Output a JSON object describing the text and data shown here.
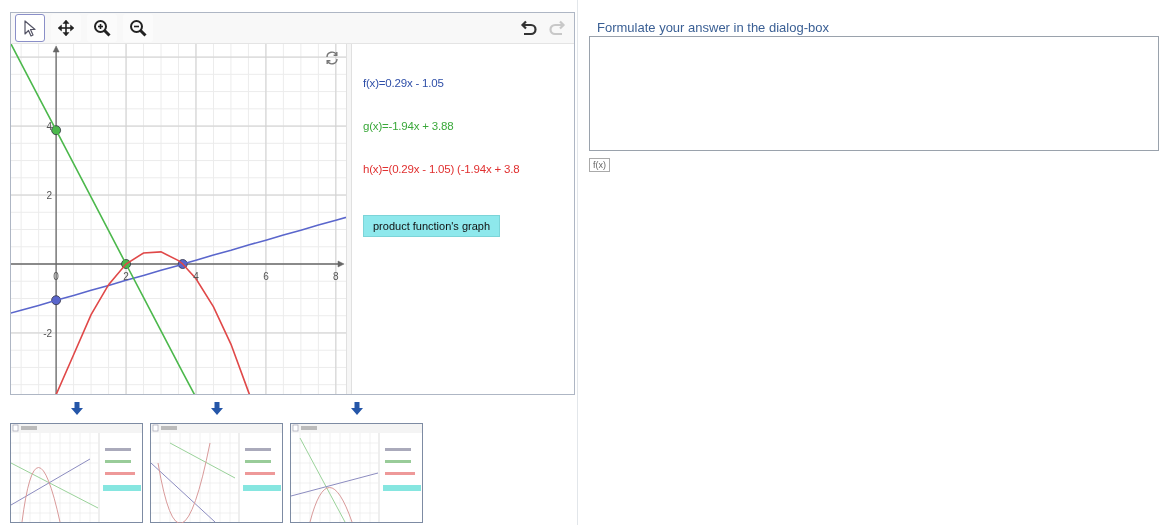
{
  "applet": {
    "toolbar": {
      "tools": [
        {
          "kind": "pointer",
          "selected": true
        },
        {
          "kind": "move",
          "selected": false
        },
        {
          "kind": "zoom_in",
          "selected": false
        },
        {
          "kind": "zoom_out",
          "selected": false
        }
      ],
      "history": [
        {
          "kind": "undo",
          "disabled": false
        },
        {
          "kind": "redo",
          "disabled": true
        }
      ]
    },
    "graph": {
      "chart_data": {
        "type": "line",
        "x": [
          -1,
          -0.5,
          0,
          0.5,
          1,
          1.5,
          2,
          2.5,
          3,
          3.5,
          3.62,
          4,
          4.5,
          5,
          5.5,
          6,
          6.5,
          7,
          7.5,
          8
        ],
        "series": [
          {
            "color": "#5a66cc",
            "values": [
              -1.34,
              -1.2,
              -1.05,
              -0.91,
              -0.76,
              -0.62,
              -0.47,
              -0.33,
              -0.18,
              -0.04,
              0,
              0.11,
              0.26,
              0.4,
              0.55,
              0.69,
              0.84,
              0.98,
              1.13,
              1.27
            ]
          },
          {
            "color": "#4cb84c",
            "values": [
              5.82,
              4.85,
              3.88,
              2.91,
              1.94,
              0.97,
              0,
              -0.97,
              -1.94,
              -2.91,
              -3.14,
              null,
              null,
              null,
              null,
              null,
              null,
              null,
              null,
              null
            ]
          },
          {
            "color": "#e04848",
            "values": [
              null,
              null,
              null,
              -2.63,
              -1.47,
              -0.6,
              0,
              0.32,
              0.35,
              0.1,
              0,
              -0.43,
              -1.24,
              -2.33,
              -3.7,
              null,
              null,
              null,
              null,
              null
            ]
          }
        ],
        "xlim": [
          -1.29,
          8.29
        ],
        "ylim": [
          -3.77,
          6.38
        ],
        "xticks": [
          0,
          2,
          4,
          6,
          8
        ],
        "yticks": [
          -2,
          2,
          4
        ],
        "grid": true
      }
    },
    "algebra": {
      "items": [
        {
          "text": "f(x)=0.29x - 1.05",
          "color": "#2f4fa8"
        },
        {
          "text": "g(x)=-1.94x + 3.88",
          "color": "#3aa83a"
        },
        {
          "text": "h(x)=(0.29x - 1.05) (-1.94x + 3.8",
          "color": "#e03030"
        }
      ],
      "button": "product function's graph"
    }
  },
  "answer": {
    "label": "Formulate your answer in the dialog-box",
    "formula_button": "f(x)"
  }
}
